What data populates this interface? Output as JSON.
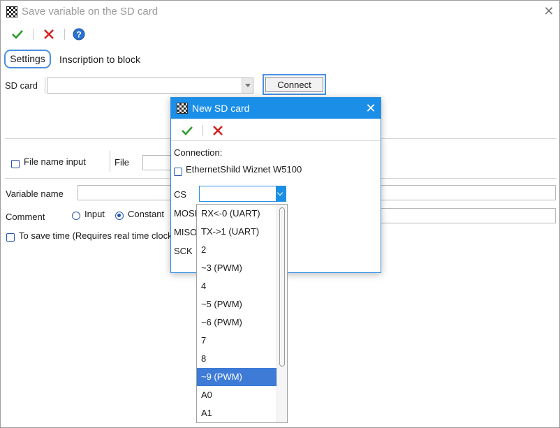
{
  "window": {
    "title": "Save variable on the SD card",
    "close_symbol": "✕"
  },
  "toolbar": {
    "ok_icon": "check-icon",
    "cancel_icon": "cross-icon",
    "help_icon": "help-icon"
  },
  "tabs": {
    "settings_label": "Settings",
    "inscription_label": "Inscription to block"
  },
  "sd_card": {
    "label": "SD card",
    "value": "",
    "connect_label": "Connect"
  },
  "file": {
    "file_name_input_label": "File name input",
    "file_label": "File",
    "file_value": ""
  },
  "variable": {
    "label": "Variable name",
    "value": ""
  },
  "comment": {
    "label": "Comment",
    "input_label": "Input",
    "constant_label": "Constant",
    "selected": "Constant"
  },
  "save_time": {
    "label": "To save time (Requires real time clock"
  },
  "dialog": {
    "title": "New SD card",
    "close_symbol": "✕",
    "connection_label": "Connection:",
    "ethernet_label": "EthernetShild Wiznet W5100",
    "cs_label": "CS",
    "cs_value": "",
    "mosi_label": "MOSI",
    "miso_label": "MISO",
    "sck_label": "SCK"
  },
  "dropdown": {
    "items": [
      "RX<-0 (UART)",
      "TX->1 (UART)",
      "2",
      "~3 (PWM)",
      "4",
      "~5 (PWM)",
      "~6 (PWM)",
      "7",
      "8",
      "~9 (PWM)",
      "A0",
      "A1"
    ],
    "selected": "~9 (PWM)"
  },
  "colors": {
    "accent": "#1b8fe8",
    "selection": "#3d7bd6",
    "check_green": "#2e9a2e",
    "cross_red": "#d42020"
  }
}
